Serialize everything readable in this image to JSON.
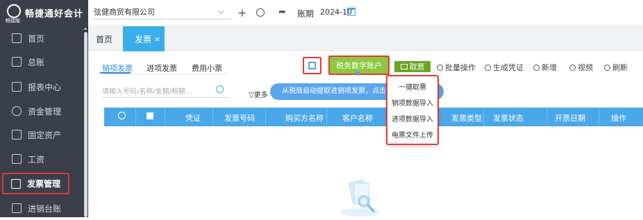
{
  "sidebar": {
    "brand": "畅捷通好会计",
    "version": "畅捷版",
    "items": [
      {
        "label": "首页",
        "icon": "home-icon"
      },
      {
        "label": "总账",
        "icon": "ledger-icon"
      },
      {
        "label": "报表中心",
        "icon": "chart-icon"
      },
      {
        "label": "资金管理",
        "icon": "fund-icon"
      },
      {
        "label": "固定资产",
        "icon": "asset-icon"
      },
      {
        "label": "工资",
        "icon": "salary-icon"
      },
      {
        "label": "发票管理",
        "icon": "invoice-icon"
      },
      {
        "label": "进销台账",
        "icon": "inventory-icon"
      }
    ]
  },
  "topbar": {
    "company": "弦健商贸有限公司",
    "plus": "+",
    "period_label": "账期",
    "period_value": "2024-10"
  },
  "tabs": {
    "home": "首页",
    "invoice": "发票",
    "close": "×"
  },
  "subtabs": {
    "sales": "销项发票",
    "purchase": "进项发票",
    "expense": "费用小票"
  },
  "toolbar": {
    "tax_account": "税务数字账户",
    "fetch": "取票",
    "batch": "批量操作",
    "voucher": "生成凭证",
    "add": "新增",
    "video": "视频",
    "refresh": "刷新"
  },
  "search": {
    "placeholder": "请输入号码/名称/金额/税额...",
    "more": "更多"
  },
  "tip": "从税局自动提取进销项发票，点击",
  "table": {
    "headers": [
      "凭证",
      "发票号码",
      "购买方名称",
      "客户名称",
      "发票类型",
      "发票状态",
      "开票日期",
      "操作"
    ]
  },
  "dropdown": {
    "items": [
      "一键取票",
      "销项数据导入",
      "进项数据导入",
      "电票文件上传"
    ]
  },
  "colors": {
    "sidebar_bg": "#3a3f4b",
    "accent_blue": "#3aaee8",
    "tax_green": "#8ec63f",
    "fetch_green": "#6aa526",
    "highlight_red": "#e53935"
  }
}
